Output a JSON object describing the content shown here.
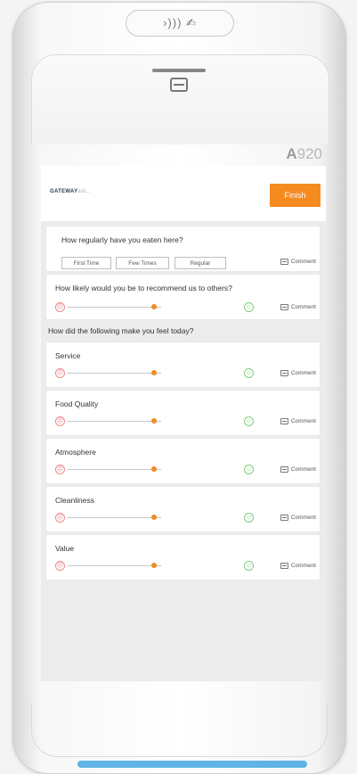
{
  "device": {
    "model": "A920",
    "model_prefix": "A",
    "model_number": "920",
    "nfc_symbol": "›))) ✍"
  },
  "header": {
    "logo_main": "GATEWAY",
    "logo_tag": "sol...",
    "finish_label": "Finish"
  },
  "survey": {
    "frequency": {
      "question": "How regularly have you eaten here?",
      "choices": [
        "First Time",
        "Few Times",
        "Regular"
      ],
      "comment_label": "Comment"
    },
    "recommend": {
      "question": "How likely would you be to recommend us to others?",
      "comment_label": "Comment",
      "value": 0.5
    },
    "section_title": "How did the following make you feel today?",
    "items": [
      {
        "label": "Service",
        "comment_label": "Comment",
        "value": 0.5
      },
      {
        "label": "Food Quality",
        "comment_label": "Comment",
        "value": 0.5
      },
      {
        "label": "Atmosphere",
        "comment_label": "Comment",
        "value": 0.5
      },
      {
        "label": "Cleanliness",
        "comment_label": "Comment",
        "value": 0.5
      },
      {
        "label": "Value",
        "comment_label": "Comment",
        "value": 0.5
      }
    ]
  },
  "colors": {
    "accent": "#f58a1f",
    "sad": "#f08a8a",
    "happy": "#7ccf7c",
    "bottom_bar": "#5fb3e6"
  },
  "icons": {
    "sad": "sad-face-icon",
    "happy": "happy-face-icon",
    "comment": "comment-icon",
    "nfc": "contactless-icon",
    "printer": "printer-icon"
  }
}
